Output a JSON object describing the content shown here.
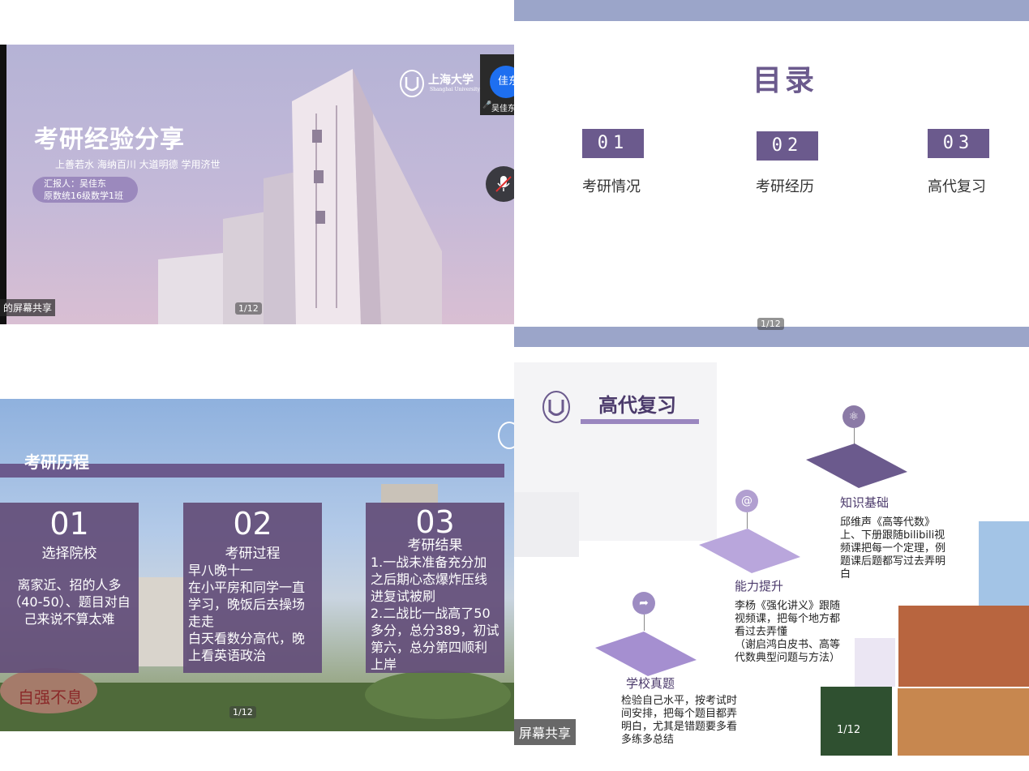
{
  "panel1": {
    "title": "考研经验分享",
    "motto": "上善若水 海纳百川 大道明德 学用济世",
    "reporter_line1": "汇报人：吴佳东",
    "reporter_line2": "原数统16级数学1班",
    "logo_cn": "上海大学",
    "logo_en": "Shanghai University",
    "avatar_text": "佳东",
    "participant_name": "吴佳东",
    "share_label": "的屏幕共享",
    "page": "1/12"
  },
  "panel2": {
    "title": "目录",
    "items": [
      {
        "num": "01",
        "label": "考研情况"
      },
      {
        "num": "02",
        "label": "考研经历"
      },
      {
        "num": "03",
        "label": "高代复习"
      }
    ],
    "page": "1/12",
    "accent": "#6b5a8d"
  },
  "panel3": {
    "title": "考研历程",
    "cards": [
      {
        "num": "01",
        "head": "选择院校",
        "body": "离家近、招的人多（40-50）、题目对自己来说不算太难"
      },
      {
        "num": "02",
        "head": "考研过程",
        "body": "早八晚十一\n在小平房和同学一直学习，晚饭后去操场走走\n白天看数分高代，晚上看英语政治"
      },
      {
        "num": "03",
        "head": "考研结果",
        "body": "1.一战未准备充分加之后期心态爆炸压线进复试被刷\n2.二战比一战高了50多分，总分389，初试第六，总分第四顺利上岸"
      }
    ],
    "rock_text": "自强不息",
    "page": "1/12"
  },
  "panel4": {
    "title": "高代复习",
    "stages": [
      {
        "title": "学校真题",
        "desc": "检验自己水平，按考试时间安排，把每个题目都弄明白，尤其是错题要多看多练多总结",
        "icon": "share-icon"
      },
      {
        "title": "能力提升",
        "desc": "李杨《强化讲义》跟随视频课，把每个地方都看过去弄懂\n（谢启鸿白皮书、高等代数典型问题与方法）",
        "icon": "at-icon"
      },
      {
        "title": "知识基础",
        "desc": "邱维声《高等代数》上、下册跟随bilibili视频课把每一个定理，例题课后题都写过去弄明白",
        "icon": "atom-icon"
      }
    ],
    "share_label": "屏幕共享",
    "page": "1/12"
  }
}
